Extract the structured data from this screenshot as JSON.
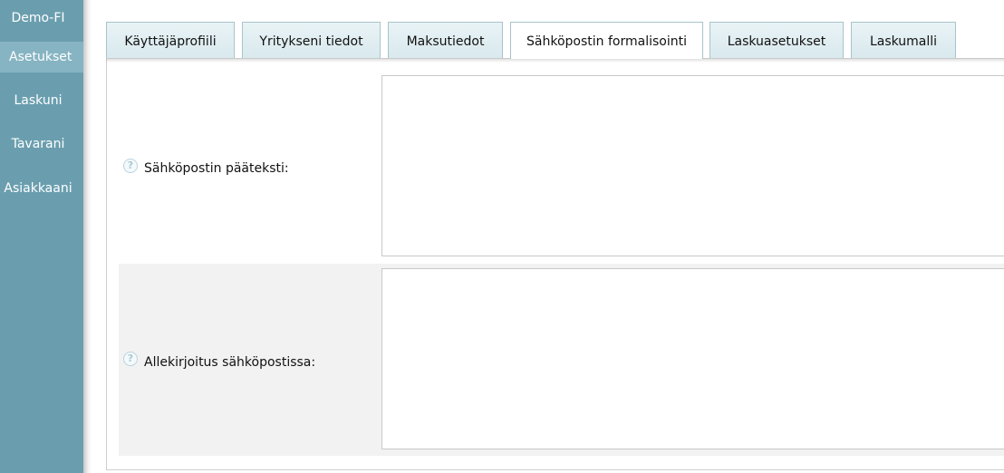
{
  "sidebar": {
    "title": "Demo-FI",
    "items": [
      {
        "label": "Asetukset",
        "active": true
      },
      {
        "label": "Laskuni",
        "active": false
      },
      {
        "label": "Tavarani",
        "active": false
      },
      {
        "label": "Asiakkaani",
        "active": false
      }
    ]
  },
  "tabs": [
    {
      "label": "Käyttäjäprofiili",
      "active": false
    },
    {
      "label": "Yritykseni tiedot",
      "active": false
    },
    {
      "label": "Maksutiedot",
      "active": false
    },
    {
      "label": "Sähköpostin formalisointi",
      "active": true
    },
    {
      "label": "Laskuasetukset",
      "active": false
    },
    {
      "label": "Laskumalli",
      "active": false
    }
  ],
  "form": {
    "fields": [
      {
        "label": "Sähköpostin pääteksti:",
        "value": "",
        "help_icon": "question-icon"
      },
      {
        "label": "Allekirjoitus sähköpostissa:",
        "value": "",
        "help_icon": "question-icon"
      }
    ]
  },
  "colors": {
    "sidebar_bg": "#6a9eaf",
    "sidebar_active": "#86b4c2",
    "tab_bg": "#e0eef2",
    "tab_border": "#a9c3cc",
    "row_alt_bg": "#f2f2f2"
  }
}
